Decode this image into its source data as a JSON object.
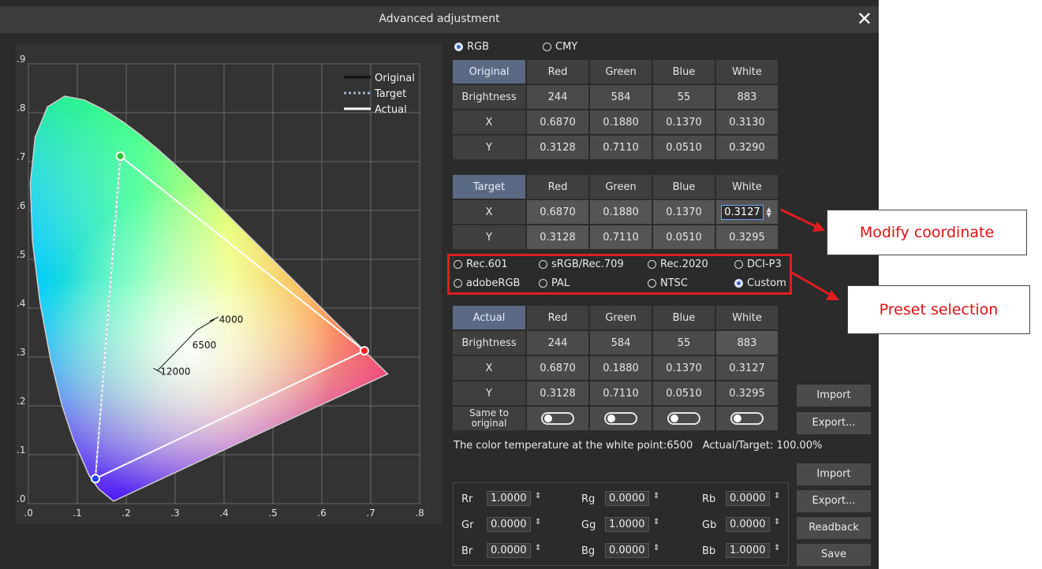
{
  "window": {
    "title": "Advanced adjustment",
    "close_glyph": "✕"
  },
  "mode": {
    "rgb_label": "RGB",
    "cmy_label": "CMY",
    "selected": "RGB"
  },
  "chart_data": {
    "type": "scatter",
    "xticks": [
      ".0",
      ".1",
      ".2",
      ".3",
      ".4",
      ".5",
      ".6",
      ".7",
      ".8"
    ],
    "yticks": [
      ".0",
      ".1",
      ".2",
      ".3",
      ".4",
      ".5",
      ".6",
      ".7",
      ".8",
      ".9"
    ],
    "xlim": [
      0,
      0.8
    ],
    "ylim": [
      0,
      0.9
    ],
    "legend": [
      "Original",
      "Target",
      "Actual"
    ],
    "legend_position": "top-right",
    "triangle": [
      [
        0.687,
        0.3128
      ],
      [
        0.188,
        0.711
      ],
      [
        0.137,
        0.051
      ]
    ],
    "cct_labels": [
      "4000",
      "6500",
      "12000"
    ]
  },
  "original": {
    "corner": "Original",
    "cols": [
      "Red",
      "Green",
      "Blue",
      "White"
    ],
    "rows": [
      {
        "label": "Brightness",
        "values": [
          "244",
          "584",
          "55",
          "883"
        ]
      },
      {
        "label": "X",
        "values": [
          "0.6870",
          "0.1880",
          "0.1370",
          "0.3130"
        ]
      },
      {
        "label": "Y",
        "values": [
          "0.3128",
          "0.7110",
          "0.0510",
          "0.3290"
        ]
      }
    ]
  },
  "target": {
    "corner": "Target",
    "cols": [
      "Red",
      "Green",
      "Blue",
      "White"
    ],
    "rows": [
      {
        "label": "X",
        "values": [
          "0.6870",
          "0.1880",
          "0.1370",
          "0.3127"
        ]
      },
      {
        "label": "Y",
        "values": [
          "0.3128",
          "0.7110",
          "0.0510",
          "0.3295"
        ]
      }
    ]
  },
  "presets": {
    "items": [
      "Rec.601",
      "sRGB/Rec.709",
      "Rec.2020",
      "DCI-P3",
      "adobeRGB",
      "PAL",
      "NTSC",
      "Custom"
    ],
    "selected": "Custom"
  },
  "actual": {
    "corner": "Actual",
    "cols": [
      "Red",
      "Green",
      "Blue",
      "White"
    ],
    "rows": [
      {
        "label": "Brightness",
        "values": [
          "244",
          "584",
          "55",
          "883"
        ]
      },
      {
        "label": "X",
        "values": [
          "0.6870",
          "0.1880",
          "0.1370",
          "0.3127"
        ]
      },
      {
        "label": "Y",
        "values": [
          "0.3128",
          "0.7110",
          "0.0510",
          "0.3295"
        ]
      }
    ],
    "same_label_1": "Same to",
    "same_label_2": "original"
  },
  "status": {
    "text": "The color temperature at the white point:6500   Actual/Target: 100.00%"
  },
  "buttons": {
    "import": "Import",
    "export": "Export...",
    "import2": "Import",
    "export2": "Export...",
    "readback": "Readback",
    "save": "Save"
  },
  "matrix": [
    [
      {
        "k": "Rr",
        "v": "1.0000"
      },
      {
        "k": "Rg",
        "v": "0.0000"
      },
      {
        "k": "Rb",
        "v": "0.0000"
      }
    ],
    [
      {
        "k": "Gr",
        "v": "0.0000"
      },
      {
        "k": "Gg",
        "v": "1.0000"
      },
      {
        "k": "Gb",
        "v": "0.0000"
      }
    ],
    [
      {
        "k": "Br",
        "v": "0.0000"
      },
      {
        "k": "Bg",
        "v": "0.0000"
      },
      {
        "k": "Bb",
        "v": "1.0000"
      }
    ]
  ],
  "callouts": {
    "modify": "Modify coordinate",
    "preset": "Preset selection"
  },
  "colors": {
    "accent": "#e01e1e",
    "selected_radio": "#3a63c9",
    "focus": "#66a6ff"
  }
}
